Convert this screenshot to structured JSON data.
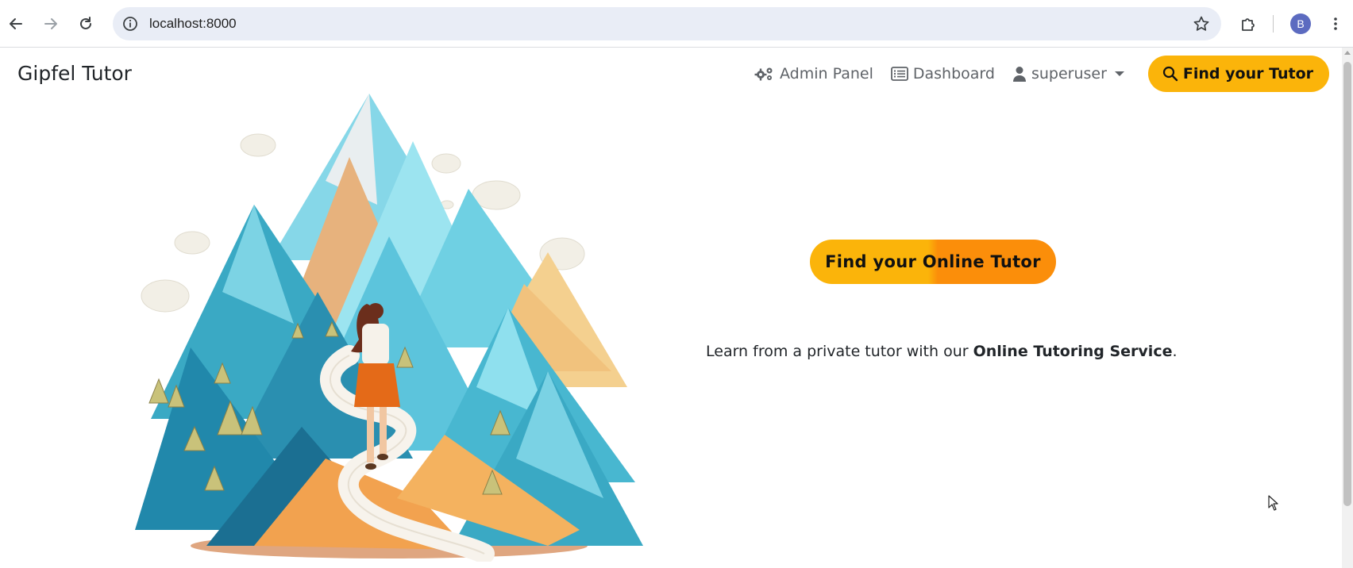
{
  "browser": {
    "url": "localhost:8000",
    "profile_initial": "B",
    "icons": {
      "back": "arrow-left-icon",
      "forward": "arrow-right-icon",
      "reload": "reload-icon",
      "site_info": "info-icon",
      "bookmark": "star-icon",
      "extensions": "puzzle-icon",
      "menu": "kebab-menu-icon"
    }
  },
  "navbar": {
    "brand": "Gipfel Tutor",
    "admin_panel": "Admin Panel",
    "dashboard": "Dashboard",
    "user": "superuser",
    "find_button": "Find your Tutor",
    "icons": {
      "admin_panel": "gears-icon",
      "dashboard": "list-icon",
      "user": "user-icon",
      "find": "search-icon"
    }
  },
  "hero": {
    "cta_label": "Find your Online Tutor",
    "tagline_prefix": "Learn from a private tutor with our ",
    "tagline_strong": "Online Tutoring Service",
    "tagline_suffix": ".",
    "illustration": "mountain-hiker-illustration"
  },
  "colors": {
    "accent": "#fbb40a",
    "accent_dark": "#fb8e0a",
    "text": "#212529",
    "nav_text": "#5f6368"
  }
}
